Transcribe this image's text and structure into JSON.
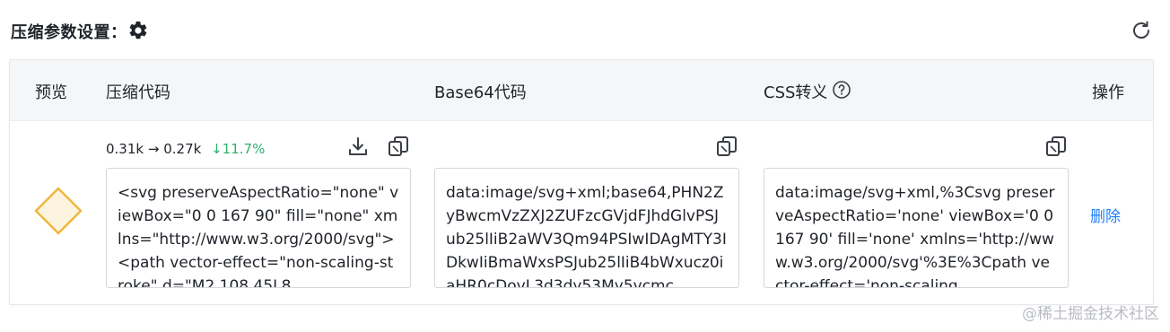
{
  "header": {
    "title": "压缩参数设置："
  },
  "table": {
    "columns": {
      "preview": "预览",
      "compress": "压缩代码",
      "base64": "Base64代码",
      "css": "CSS转义",
      "action": "操作"
    },
    "row": {
      "size_before": "0.31k",
      "arrow": "→",
      "size_after": "0.27k",
      "reduction": "↓11.7%",
      "compressed_code": "<svg preserveAspectRatio=\"none\" viewBox=\"0 0 167 90\" fill=\"none\" xmlns=\"http://www.w3.org/2000/svg\"><path vector-effect=\"non-scaling-stroke\" d=\"M2 108.45L8",
      "base64_code": "data:image/svg+xml;base64,PHN2ZyBwcmVzZXJ2ZUFzcGVjdFJhdGlvPSJub25lIiB2aWV3Qm94PSIwIDAgMTY3IDkwIiBmaWxsPSJub25lIiB4bWxucz0iaHR0cDovL3d3dy53My5vcmc",
      "css_code": "data:image/svg+xml,%3Csvg preserveAspectRatio='none' viewBox='0 0 167 90' fill='none' xmlns='http://www.w3.org/2000/svg'%3E%3Cpath vector-effect='non-scaling",
      "delete_label": "删除"
    }
  },
  "icons": {
    "settings": "gear-icon",
    "refresh": "refresh-icon",
    "help": "question-circle-icon",
    "download": "download-icon",
    "copy": "copy-icon"
  },
  "colors": {
    "accent": "#1e80ff",
    "success": "#2fb06a",
    "diamond_stroke": "#f0b63e",
    "diamond_fill": "#fdf4e0"
  },
  "watermark": "@稀土掘金技术社区"
}
